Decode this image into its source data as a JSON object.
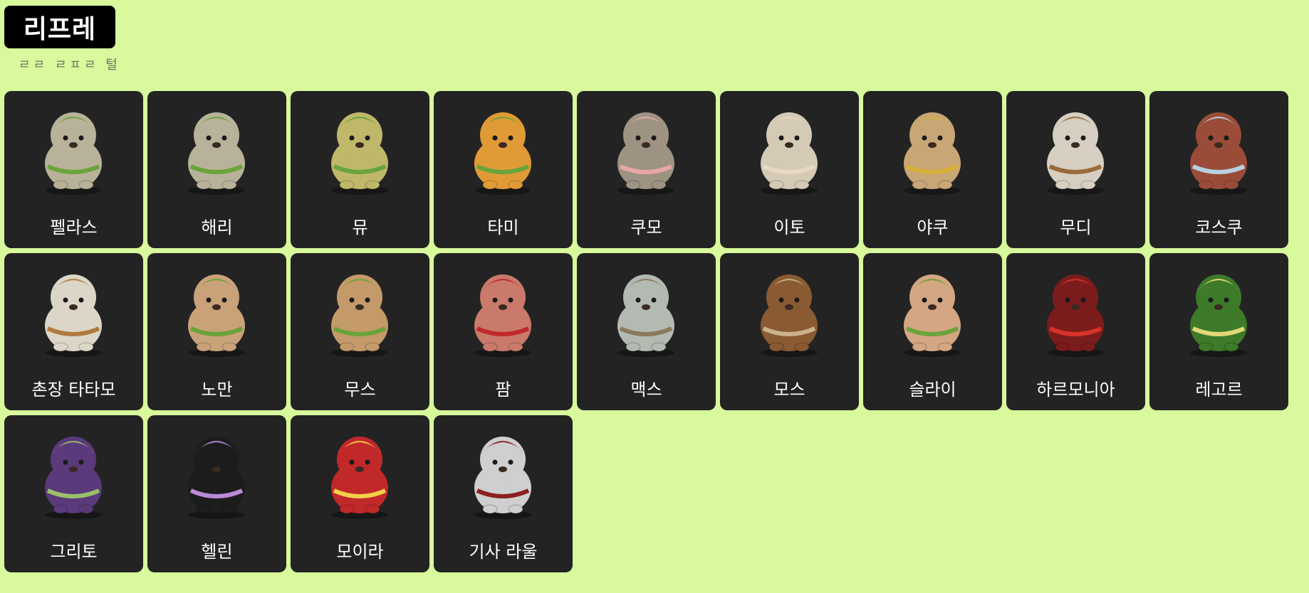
{
  "header": {
    "title": "리프레",
    "subtitle": "ㄹㄹ ㄹㅍㄹ 털"
  },
  "cards": [
    {
      "label": "펠라스",
      "icon": "pellas-portrait-icon",
      "body": "#b9b29a",
      "accent": "#6aa33a"
    },
    {
      "label": "해리",
      "icon": "harry-portrait-icon",
      "body": "#b9b29a",
      "accent": "#6aa33a"
    },
    {
      "label": "뮤",
      "icon": "mu-portrait-icon",
      "body": "#bfb76a",
      "accent": "#6aa33a"
    },
    {
      "label": "타미",
      "icon": "tami-portrait-icon",
      "body": "#e09b36",
      "accent": "#6aa33a"
    },
    {
      "label": "쿠모",
      "icon": "kumo-portrait-icon",
      "body": "#9e9382",
      "accent": "#e7a7a7"
    },
    {
      "label": "이토",
      "icon": "ito-portrait-icon",
      "body": "#d4cab6",
      "accent": "#e7d9c2"
    },
    {
      "label": "야쿠",
      "icon": "yaku-portrait-icon",
      "body": "#c9a676",
      "accent": "#d7b03a"
    },
    {
      "label": "무디",
      "icon": "mudi-portrait-icon",
      "body": "#d6cfc2",
      "accent": "#9a6a3a"
    },
    {
      "label": "코스쿠",
      "icon": "kosuku-portrait-icon",
      "body": "#9a4c38",
      "accent": "#b6d2e2"
    },
    {
      "label": "촌장 타타모",
      "icon": "chief-tatamo-portrait-icon",
      "body": "#dcd6c8",
      "accent": "#b07a3e"
    },
    {
      "label": "노만",
      "icon": "noman-portrait-icon",
      "body": "#c9a27a",
      "accent": "#6aa33a"
    },
    {
      "label": "무스",
      "icon": "moose-portrait-icon",
      "body": "#c49a6a",
      "accent": "#6aa33a"
    },
    {
      "label": "팜",
      "icon": "pam-portrait-icon",
      "body": "#c97a6a",
      "accent": "#c0282a"
    },
    {
      "label": "맥스",
      "icon": "max-portrait-icon",
      "body": "#b2bab2",
      "accent": "#8a7a5a"
    },
    {
      "label": "모스",
      "icon": "moss-portrait-icon",
      "body": "#8a5a32",
      "accent": "#c9b48a"
    },
    {
      "label": "슬라이",
      "icon": "sly-portrait-icon",
      "body": "#d4a682",
      "accent": "#6aa33a"
    },
    {
      "label": "하르모니아",
      "icon": "harmonia-portrait-icon",
      "body": "#7a1c1c",
      "accent": "#d8332a"
    },
    {
      "label": "레고르",
      "icon": "legor-portrait-icon",
      "body": "#3d7a2a",
      "accent": "#e2d878"
    },
    {
      "label": "그리토",
      "icon": "grito-portrait-icon",
      "body": "#5a3a7a",
      "accent": "#9ac06a"
    },
    {
      "label": "헬린",
      "icon": "helin-portrait-icon",
      "body": "#1c1c1c",
      "accent": "#b88ad8"
    },
    {
      "label": "모이라",
      "icon": "moira-portrait-icon",
      "body": "#c0282a",
      "accent": "#f2d04a"
    },
    {
      "label": "기사 라울",
      "icon": "knight-raoul-portrait-icon",
      "body": "#cfcfcf",
      "accent": "#8a2020"
    }
  ]
}
